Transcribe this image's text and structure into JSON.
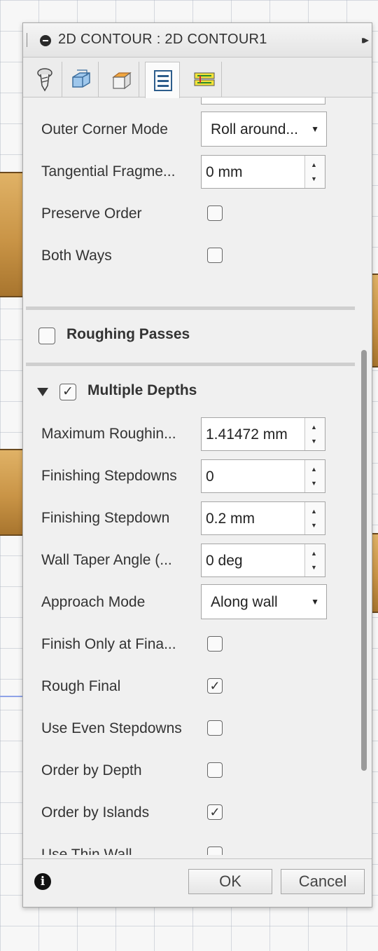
{
  "window": {
    "title": "2D CONTOUR : 2D CONTOUR1"
  },
  "tabs": [
    {
      "name": "tool-tab"
    },
    {
      "name": "geometry-tab"
    },
    {
      "name": "heights-tab"
    },
    {
      "name": "passes-tab",
      "active": true
    },
    {
      "name": "linking-tab"
    }
  ],
  "fields": {
    "outer_corner_mode": {
      "label": "Outer Corner Mode",
      "value": "Roll around..."
    },
    "tangential_fragment": {
      "label": "Tangential Fragme...",
      "value": "0 mm"
    },
    "preserve_order": {
      "label": "Preserve Order",
      "checked": false
    },
    "both_ways": {
      "label": "Both Ways",
      "checked": false
    }
  },
  "roughing": {
    "label": "Roughing Passes",
    "checked": false
  },
  "multiple_depths": {
    "label": "Multiple Depths",
    "checked": true,
    "check_glyph": "✓",
    "max_roughing": {
      "label": "Maximum Roughin...",
      "value": "1.41472 mm"
    },
    "finishing_stepdowns": {
      "label": "Finishing Stepdowns",
      "value": "0"
    },
    "finishing_stepdown": {
      "label": "Finishing Stepdown",
      "value": "0.2 mm"
    },
    "wall_taper": {
      "label": "Wall Taper Angle (...",
      "value": "0 deg"
    },
    "approach_mode": {
      "label": "Approach Mode",
      "value": "Along wall"
    },
    "finish_only_final": {
      "label": "Finish Only at Fina...",
      "checked": false
    },
    "rough_final": {
      "label": "Rough Final",
      "checked": true
    },
    "use_even_stepdowns": {
      "label": "Use Even Stepdowns",
      "checked": false
    },
    "order_by_depth": {
      "label": "Order by Depth",
      "checked": false
    },
    "order_by_islands": {
      "label": "Order by Islands",
      "checked": true
    },
    "use_thin_wall": {
      "label": "Use Thin Wall",
      "checked": false
    }
  },
  "footer": {
    "ok": "OK",
    "cancel": "Cancel",
    "info_glyph": "i"
  },
  "glyphs": {
    "check": "✓",
    "up": "▲",
    "down": "▼",
    "dropdown": "▼",
    "collapse": "▸▸"
  }
}
